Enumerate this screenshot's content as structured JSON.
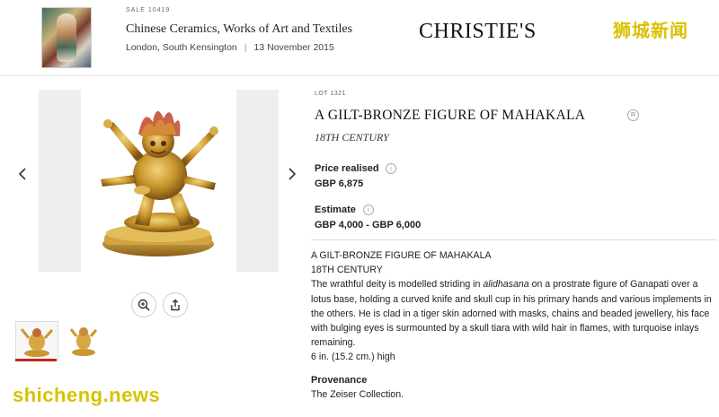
{
  "header": {
    "sale_number": "SALE 10419",
    "sale_title": "Chinese Ceramics, Works of Art and Textiles",
    "location": "London, South Kensington",
    "separator": "|",
    "date": "13 November 2015",
    "brand": "CHRISTIE'S"
  },
  "watermarks": {
    "top": "狮城新闻",
    "bottom": "shicheng.news"
  },
  "gallery": {
    "prev_icon": "chevron-left-icon",
    "next_icon": "chevron-right-icon",
    "zoom_icon": "zoom-in-icon",
    "share_icon": "share-icon",
    "thumbnails_count": 2,
    "selected_thumbnail": 1
  },
  "lot": {
    "lot_number": "LOT 1321",
    "title": "A GILT-BRONZE FIGURE OF MAHAKALA",
    "century": "18TH CENTURY",
    "price_label": "Price realised",
    "price_value": "GBP 6,875",
    "estimate_label": "Estimate",
    "estimate_value": "GBP 4,000 - GBP 6,000"
  },
  "description": {
    "title": "A GILT-BRONZE FIGURE OF MAHAKALA",
    "century": "18TH CENTURY",
    "body_pre": "The wrathful deity is modelled striding in ",
    "body_em": "alidhasana",
    "body_post": " on a prostrate figure of Ganapati over a lotus base, holding a curved knife and skull cup in his primary hands and various implements in the others. He is clad in a tiger skin adorned with masks, chains and beaded jewellery, his face with bulging eyes is surmounted by a skull tiara with wild hair in flames, with turquoise inlays remaining.",
    "size": "6 in. (15.2 cm.) high"
  },
  "provenance": {
    "label": "Provenance",
    "text": "The Zeiser Collection."
  },
  "colors": {
    "accent_red": "#c3261c",
    "watermark_yellow": "#d9c200",
    "gilt": "#c9972e"
  }
}
